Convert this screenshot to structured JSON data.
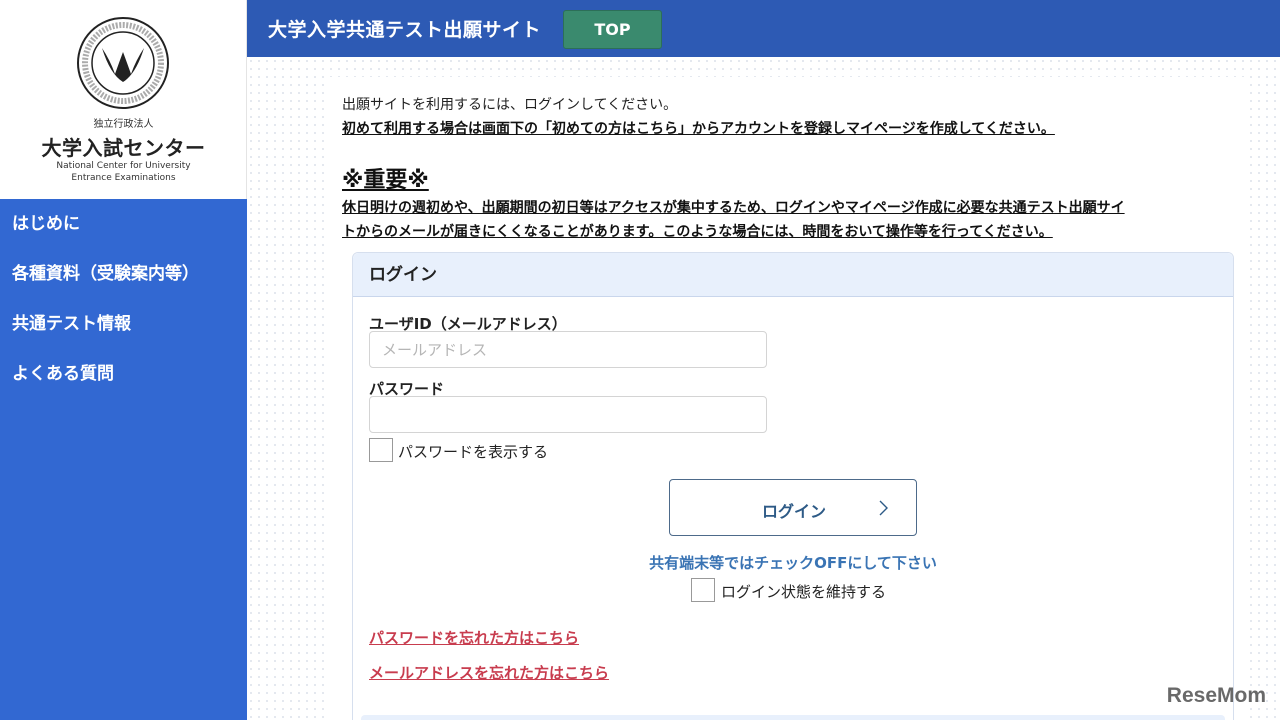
{
  "logo": {
    "org_type": "独立行政法人",
    "org_name": "大学入試センター",
    "org_name_en_1": "National Center for University",
    "org_name_en_2": "Entrance Examinations"
  },
  "sidebar": {
    "items": [
      {
        "label": "はじめに"
      },
      {
        "label": "各種資料（受験案内等）"
      },
      {
        "label": "共通テスト情報"
      },
      {
        "label": "よくある質問"
      }
    ]
  },
  "header": {
    "title": "大学入学共通テスト出願サイト",
    "top_label": "TOP"
  },
  "intro": {
    "line1": "出願サイトを利用するには、ログインしてください。",
    "line2": "初めて利用する場合は画面下の「初めての方はこちら」からアカウントを登録しマイページを作成してください。"
  },
  "important": {
    "title": "※重要※",
    "body_1": "休日明けの週初めや、出願期間の初日等はアクセスが集中するため、ログインやマイページ作成に必要な共通テスト出願サイ",
    "body_2": "トからのメールが届きにくくなることがあります。このような場合には、時間をおいて操作等を行ってください。"
  },
  "login": {
    "heading": "ログイン",
    "userid_label": "ユーザID（メールアドレス）",
    "userid_placeholder": "メールアドレス",
    "userid_value": "",
    "password_label": "パスワード",
    "password_value": "",
    "show_password_label": "パスワードを表示する",
    "login_button": "ログイン",
    "shared_notice": "共有端末等ではチェックOFFにして下さい",
    "keep_login_label": "ログイン状態を維持する",
    "forgot_password": "パスワードを忘れた方はこちら",
    "forgot_email": "メールアドレスを忘れた方はこちら"
  },
  "colors": {
    "sidebar": "#3268d2",
    "header": "#2d5ab4",
    "top_button": "#3a8a6e",
    "link": "#c83c4e",
    "notice": "#3a74b4"
  },
  "watermark": "ReseMom"
}
